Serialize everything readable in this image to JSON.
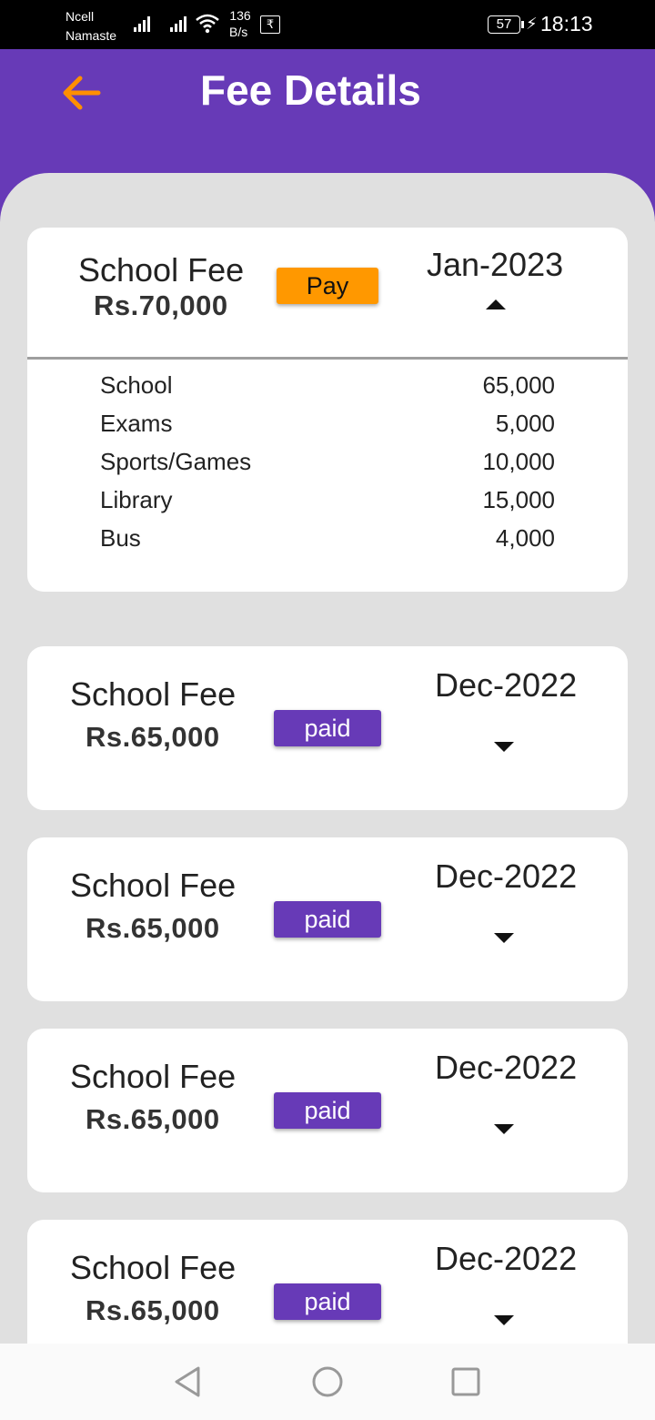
{
  "status_bar": {
    "carrier_line1": "Ncell",
    "carrier_line2": "Namaste",
    "net_speed_value": "136",
    "net_speed_unit": "B/s",
    "rupee_symbol": "₹",
    "battery": "57",
    "time": "18:13"
  },
  "header": {
    "title": "Fee Details",
    "back_icon_color": "#ff8f00"
  },
  "colors": {
    "primary": "#673ab7",
    "pay": "#ff9800",
    "background": "#e0e0e0"
  },
  "expanded_fee": {
    "name": "School Fee",
    "amount": "Rs.70,000",
    "action_label": "Pay",
    "month": "Jan-2023",
    "items": [
      {
        "label": "School",
        "value": "65,000"
      },
      {
        "label": "Exams",
        "value": "5,000"
      },
      {
        "label": "Sports/Games",
        "value": "10,000"
      },
      {
        "label": "Library",
        "value": "15,000"
      },
      {
        "label": "Bus",
        "value": "4,000"
      }
    ]
  },
  "fees": [
    {
      "name": "School Fee",
      "amount": "Rs.65,000",
      "status": "paid",
      "month": "Dec-2022"
    },
    {
      "name": "School Fee",
      "amount": "Rs.65,000",
      "status": "paid",
      "month": "Dec-2022"
    },
    {
      "name": "School Fee",
      "amount": "Rs.65,000",
      "status": "paid",
      "month": "Dec-2022"
    },
    {
      "name": "School Fee",
      "amount": "Rs.65,000",
      "status": "paid",
      "month": "Dec-2022"
    }
  ],
  "nav_bar": {
    "back": "triangle-back-icon",
    "home": "circle-home-icon",
    "recents": "square-recents-icon"
  }
}
